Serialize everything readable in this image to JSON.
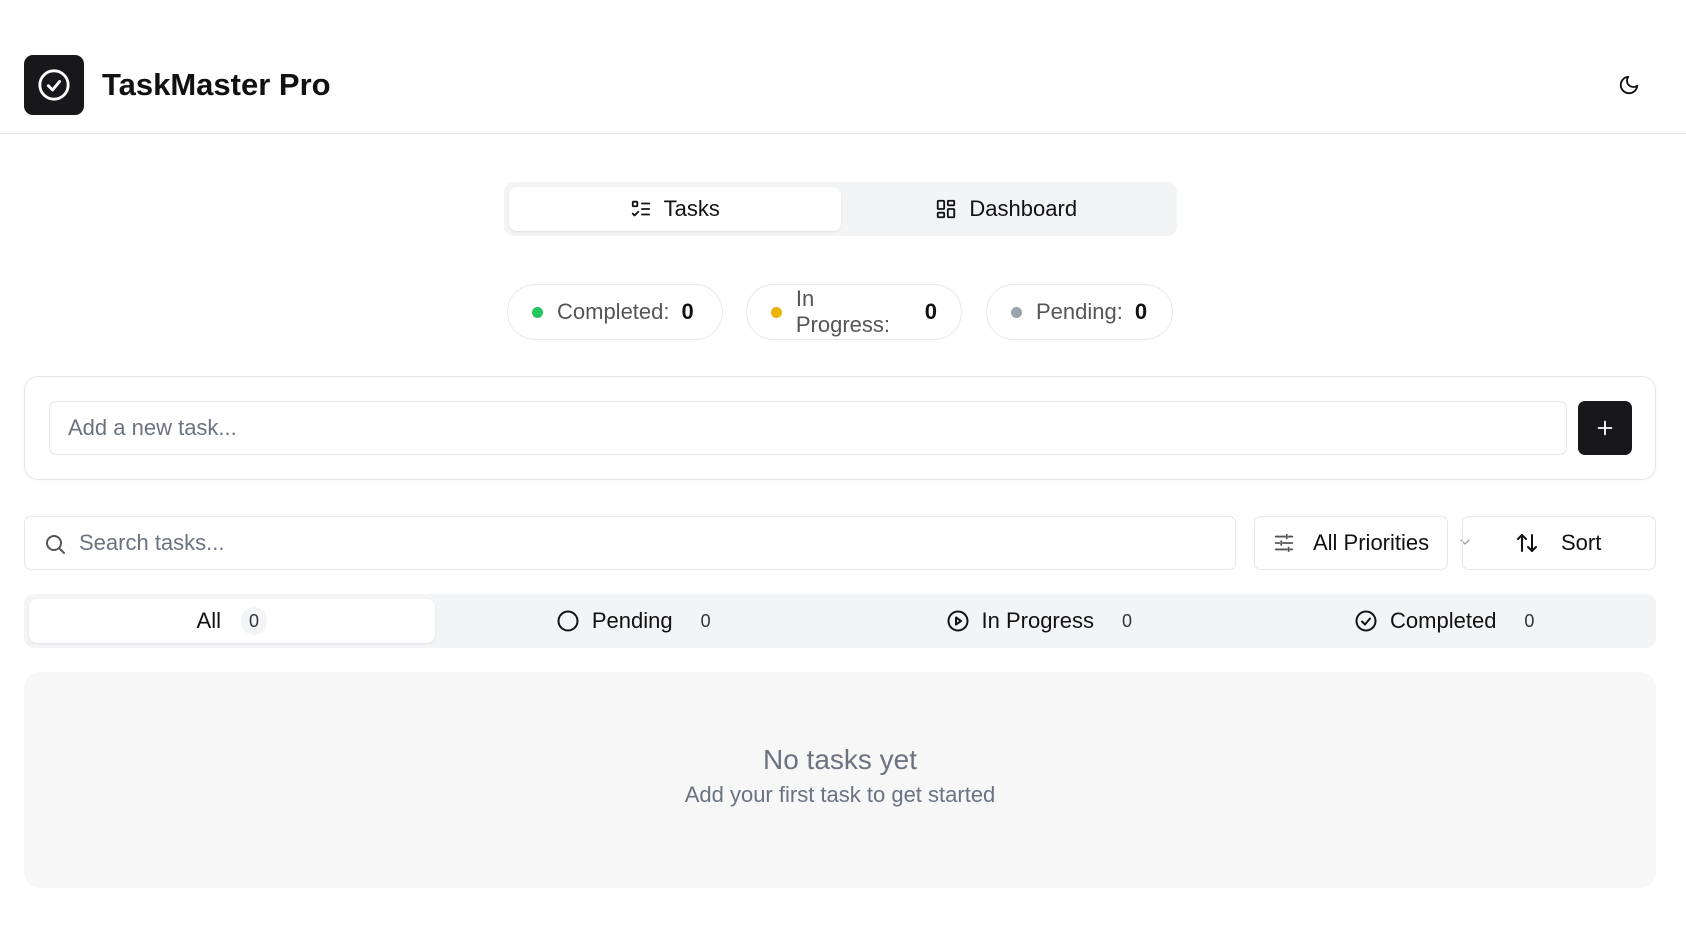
{
  "app": {
    "title": "TaskMaster Pro"
  },
  "view_tabs": [
    {
      "label": "Tasks",
      "icon": "list-checks-icon",
      "active": true
    },
    {
      "label": "Dashboard",
      "icon": "grid-icon",
      "active": false
    }
  ],
  "stats": [
    {
      "label": "Completed:",
      "count": "0",
      "color": "#22c55e"
    },
    {
      "label": "In Progress:",
      "count": "0",
      "color": "#eab308"
    },
    {
      "label": "Pending:",
      "count": "0",
      "color": "#9ca3af"
    }
  ],
  "add_task": {
    "placeholder": "Add a new task...",
    "button_icon": "plus-icon"
  },
  "search": {
    "placeholder": "Search tasks..."
  },
  "filters": {
    "priority_label": "All Priorities",
    "sort_label": "Sort"
  },
  "status_tabs": [
    {
      "label": "All",
      "count": "0",
      "active": true
    },
    {
      "label": "Pending",
      "count": "0",
      "icon": "circle-icon",
      "active": false
    },
    {
      "label": "In Progress",
      "count": "0",
      "icon": "play-circle-icon",
      "active": false
    },
    {
      "label": "Completed",
      "count": "0",
      "icon": "check-circle-icon",
      "active": false
    }
  ],
  "empty_state": {
    "title": "No tasks yet",
    "subtitle": "Add your first task to get started"
  },
  "colors": {
    "accent": "#18181b",
    "border": "#e5e7eb",
    "muted_bg": "#f3f4f6"
  }
}
